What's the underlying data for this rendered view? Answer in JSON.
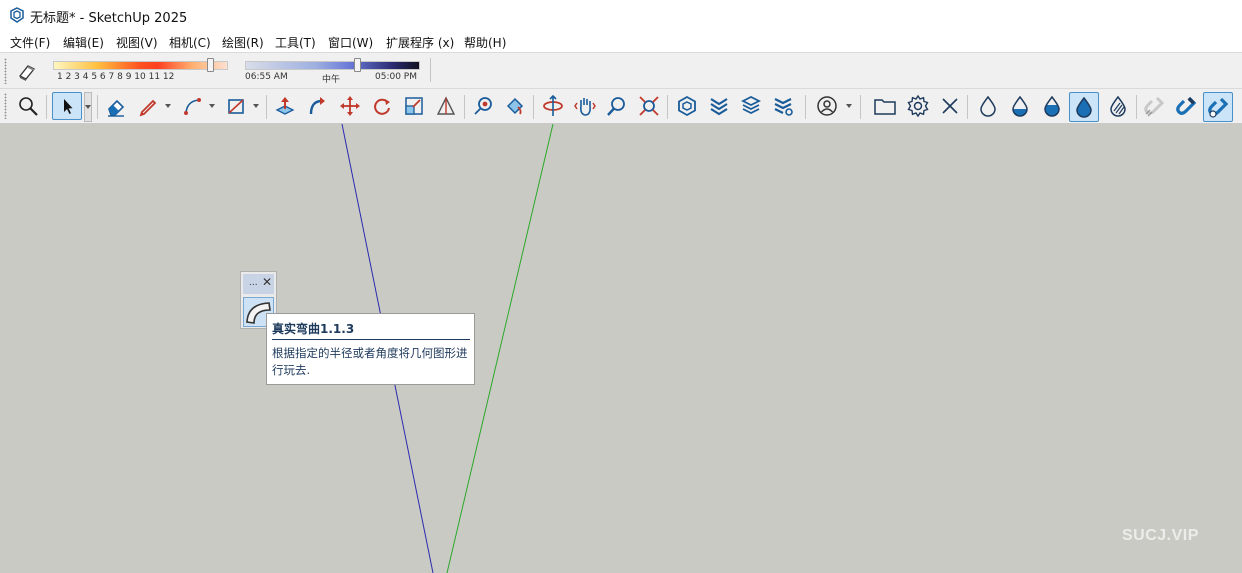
{
  "window": {
    "title": "无标题* - SketchUp 2025"
  },
  "menu": {
    "items": [
      "文件(F)",
      "编辑(E)",
      "视图(V)",
      "相机(C)",
      "绘图(R)",
      "工具(T)",
      "窗口(W)",
      "扩展程序 (x)",
      "帮助(H)"
    ]
  },
  "shadows": {
    "month_ticks": "1  2  3  4  5  6  7  8  9  10 11 12",
    "month_value": 11,
    "time_start": "06:55 AM",
    "time_mid": "中午",
    "time_end": "05:00 PM",
    "time_value_fraction": 0.65
  },
  "floating_toolbar": {
    "dots": "...",
    "close": "✕"
  },
  "tooltip": {
    "title": "真实弯曲1.1.3",
    "description": "根据指定的半径或者角度将几何图形进行玩去."
  },
  "watermark": "SUCJ.VIP",
  "colors": {
    "blue_axis": "#2a2ab0",
    "green_axis": "#2aa82a",
    "canvas": "#cacac4",
    "accent": "#1a6fb5"
  },
  "toolbar_icons": [
    "zoom-window-icon",
    "select-icon",
    "eraser-icon",
    "pencil-icon",
    "arc-icon",
    "rectangle-icon",
    "push-pull-icon",
    "follow-me-icon",
    "move-icon",
    "rotate-icon",
    "scale-icon",
    "offset-icon",
    "tape-measure-icon",
    "paint-bucket-icon",
    "orbit-icon",
    "pan-icon",
    "zoom-icon",
    "zoom-extents-icon",
    "warehouse-icon",
    "extension-warehouse-icon",
    "layout-icon",
    "extension-manager-icon",
    "profile-icon",
    "folder-icon",
    "gear-icon",
    "close-icon",
    "drop-outline-icon",
    "drop-half-icon",
    "drop-mostly-icon",
    "drop-full-icon",
    "drop-striped-icon",
    "magnet-off-icon",
    "magnet-icon",
    "magnet-settings-icon"
  ]
}
